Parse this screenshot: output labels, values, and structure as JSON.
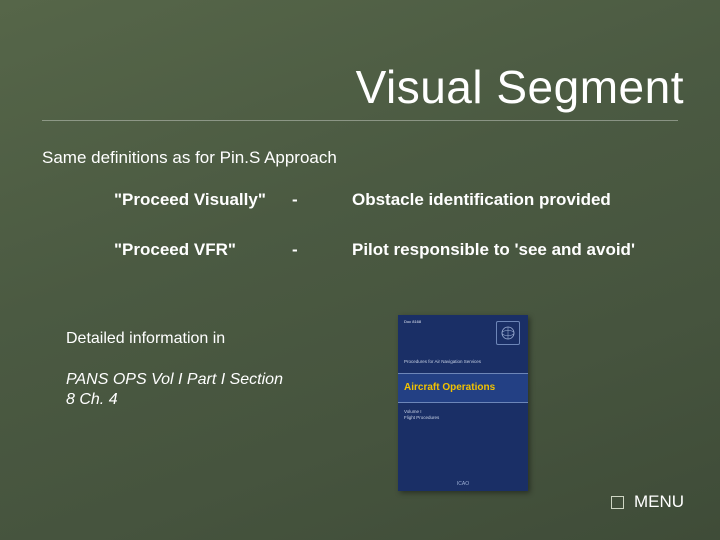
{
  "title": "Visual Segment",
  "intro": "Same definitions as for Pin.S Approach",
  "rows": [
    {
      "label": "\"Proceed Visually\"",
      "sep": "-",
      "desc": "Obstacle identification provided"
    },
    {
      "label": "\"Proceed VFR\"",
      "sep": "-",
      "desc": "Pilot responsible to 'see and avoid'"
    }
  ],
  "detailed_label": "Detailed information in",
  "reference": "PANS OPS Vol I Part I Section 8 Ch. 4",
  "book": {
    "corner_text": "Doc 8168",
    "pretitle": "Procedures for Air Navigation Services",
    "title": "Aircraft Operations",
    "sub1": "Volume I",
    "sub2": "Flight Procedures",
    "footer": "ICAO"
  },
  "menu_label": "MENU"
}
